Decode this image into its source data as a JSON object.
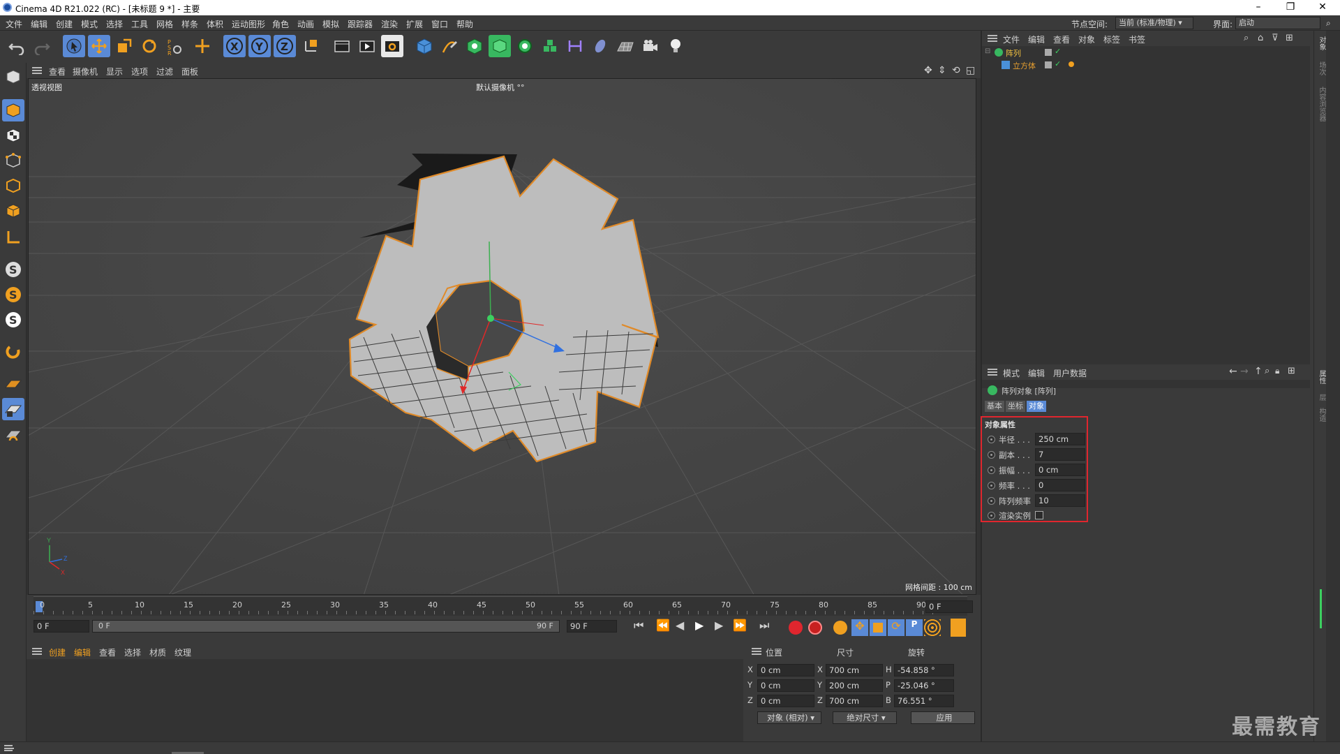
{
  "window": {
    "title": "Cinema 4D R21.022 (RC) - [未标题 9 *] - 主要"
  },
  "menu": [
    "文件",
    "编辑",
    "创建",
    "模式",
    "选择",
    "工具",
    "网格",
    "样条",
    "体积",
    "运动图形",
    "角色",
    "动画",
    "模拟",
    "跟踪器",
    "渲染",
    "扩展",
    "窗口",
    "帮助"
  ],
  "menu_right": {
    "nodespace_label": "节点空间:",
    "nodespace_value": "当前 (标准/物理)",
    "layout_label": "界面:",
    "layout_value": "启动"
  },
  "viewport": {
    "menu": [
      "查看",
      "摄像机",
      "显示",
      "选项",
      "过滤",
      "面板"
    ],
    "view_name": "透视视图",
    "camera": "默认摄像机 °°",
    "grid_spacing": "网格间距 : 100 cm"
  },
  "timeline": {
    "ticks": [
      "0",
      "5",
      "10",
      "15",
      "20",
      "25",
      "30",
      "35",
      "40",
      "45",
      "50",
      "55",
      "60",
      "65",
      "70",
      "75",
      "80",
      "85",
      "90"
    ],
    "current_frame_right": "0 F",
    "start": "0 F",
    "range_start": "0 F",
    "range_end": "90 F",
    "end": "90 F"
  },
  "material_menu": [
    "创建",
    "编辑",
    "查看",
    "选择",
    "材质",
    "纹理"
  ],
  "coords": {
    "headers": {
      "pos": "位置",
      "size": "尺寸",
      "rot": "旋转"
    },
    "rows": [
      {
        "axis": "X",
        "pos": "0 cm",
        "saxis": "X",
        "size": "700 cm",
        "raxis": "H",
        "rot": "-54.858 °"
      },
      {
        "axis": "Y",
        "pos": "0 cm",
        "saxis": "Y",
        "size": "200 cm",
        "raxis": "P",
        "rot": "-25.046 °"
      },
      {
        "axis": "Z",
        "pos": "0 cm",
        "saxis": "Z",
        "size": "700 cm",
        "raxis": "B",
        "rot": "76.551 °"
      }
    ],
    "mode": "对象 (相对)",
    "size_mode": "绝对尺寸",
    "apply": "应用"
  },
  "object_manager": {
    "menu": [
      "文件",
      "编辑",
      "查看",
      "对象",
      "标签",
      "书签"
    ],
    "objects": [
      {
        "name": "阵列",
        "color": "#f0c040"
      },
      {
        "name": "立方体",
        "color": "#e8a030"
      }
    ]
  },
  "attributes": {
    "menu": [
      "模式",
      "编辑",
      "用户数据"
    ],
    "object_title": "阵列对象 [阵列]",
    "tabs": [
      "基本",
      "坐标",
      "对象"
    ],
    "section": "对象属性",
    "props": [
      {
        "label": "半径 . . .",
        "value": "250 cm"
      },
      {
        "label": "副本 . . .",
        "value": "7"
      },
      {
        "label": "振幅 . . .",
        "value": "0 cm"
      },
      {
        "label": "频率 . . .",
        "value": "0"
      },
      {
        "label": "阵列频率",
        "value": "10"
      }
    ],
    "render_instances": "渲染实例"
  },
  "side_tabs": [
    "对象",
    "场次",
    "内容浏览器",
    "属性",
    "层",
    "构造"
  ],
  "watermark": "最需教育",
  "colors": {
    "accent_blue": "#5a8ad6",
    "highlight_red": "#e0262e",
    "selection_orange": "#e08a28"
  }
}
